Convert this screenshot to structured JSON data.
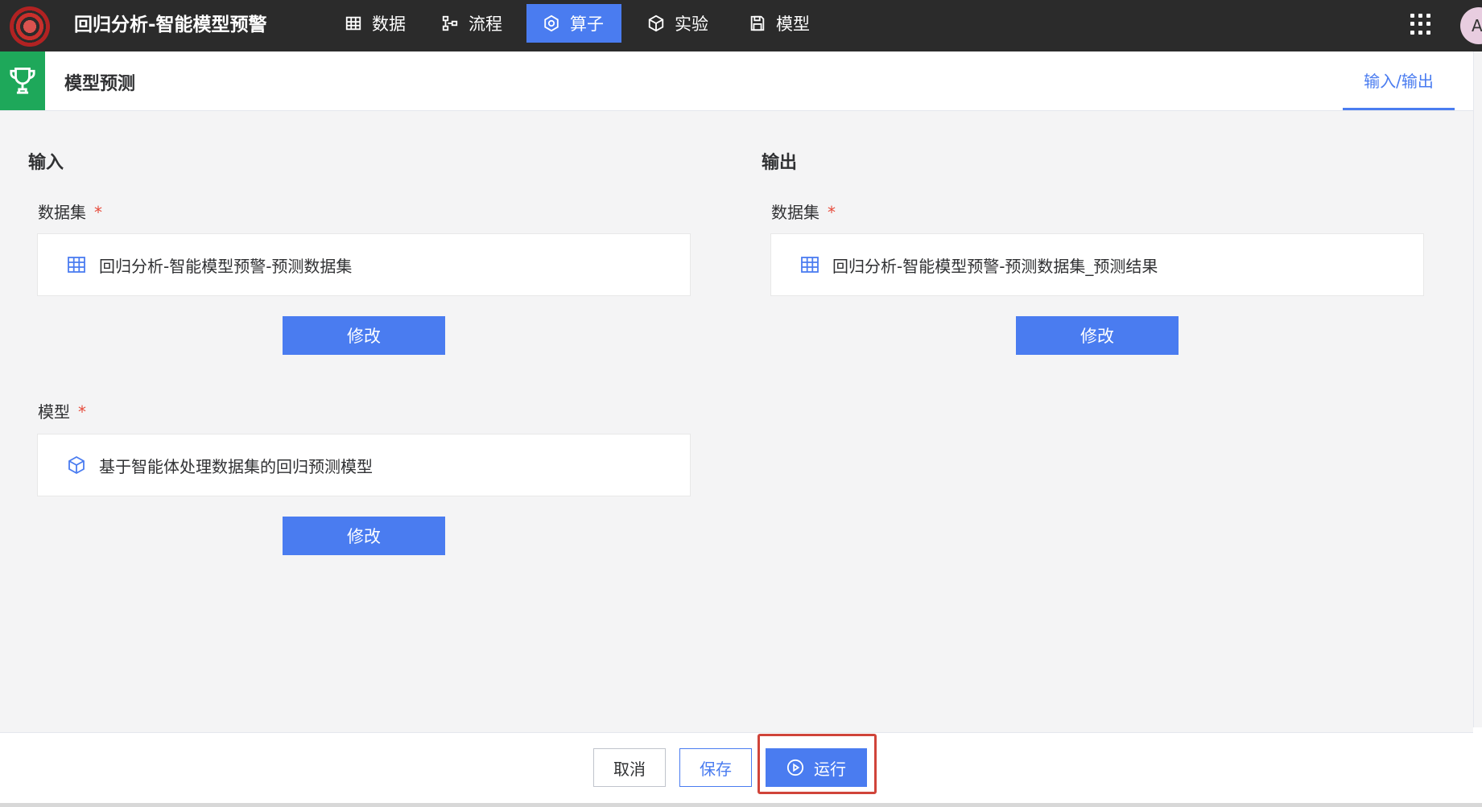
{
  "header": {
    "app_title": "回归分析-智能模型预警",
    "nav": [
      {
        "label": "数据",
        "icon": "table-icon"
      },
      {
        "label": "流程",
        "icon": "flow-icon"
      },
      {
        "label": "算子",
        "icon": "operator-icon",
        "active": true
      },
      {
        "label": "实验",
        "icon": "cube-icon"
      },
      {
        "label": "模型",
        "icon": "save-icon"
      }
    ],
    "avatar_text": "A"
  },
  "subheader": {
    "title": "模型预测",
    "tab": "输入/输出"
  },
  "input": {
    "title": "输入",
    "dataset_label": "数据集",
    "dataset_value": "回归分析-智能模型预警-预测数据集",
    "model_label": "模型",
    "model_value": "基于智能体处理数据集的回归预测模型",
    "modify_label": "修改"
  },
  "output": {
    "title": "输出",
    "dataset_label": "数据集",
    "dataset_value": "回归分析-智能模型预警-预测数据集_预测结果",
    "modify_label": "修改"
  },
  "required_mark": "*",
  "footer": {
    "cancel": "取消",
    "save": "保存",
    "run": "运行"
  },
  "colors": {
    "primary": "#4a7cf0",
    "topbar": "#2b2b2b",
    "trophy_green": "#1ea85a",
    "required": "#e74c3c",
    "highlight": "#d0443a"
  }
}
